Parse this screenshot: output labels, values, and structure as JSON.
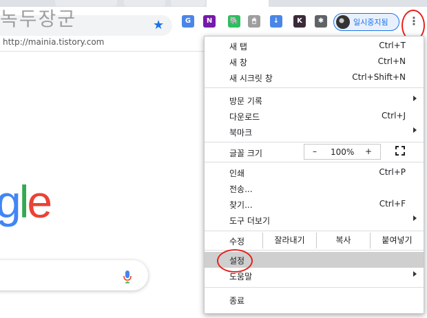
{
  "watermark": {
    "title": "녹두장군",
    "url": "http://mainia.tistory.com"
  },
  "toolbar": {
    "profile_label": "일시중지됨",
    "extensions": [
      {
        "name": "translate-extension-icon",
        "glyph": "G",
        "color": "#4a86e8"
      },
      {
        "name": "onenote-extension-icon",
        "glyph": "N",
        "color": "#7719aa"
      },
      {
        "name": "evernote-extension-icon",
        "glyph": "🐘",
        "color": "#2dbe60"
      },
      {
        "name": "mouse-extension-icon",
        "glyph": "🖱",
        "color": "#9e9e9e"
      },
      {
        "name": "file-download-extension-icon",
        "glyph": "↓",
        "color": "#4a86e8"
      },
      {
        "name": "k-extension-icon",
        "glyph": "K",
        "color": "#3c2a3a"
      },
      {
        "name": "puzzle-extension-icon",
        "glyph": "✱",
        "color": "#5f6368"
      }
    ]
  },
  "page": {
    "logo_part": [
      "g",
      "l",
      "e"
    ]
  },
  "menu": {
    "new_tab": {
      "label": "새 탭",
      "shortcut": "Ctrl+T"
    },
    "new_window": {
      "label": "새 창",
      "shortcut": "Ctrl+N"
    },
    "new_incognito": {
      "label": "새 시크릿 창",
      "shortcut": "Ctrl+Shift+N"
    },
    "history": {
      "label": "방문 기록"
    },
    "downloads": {
      "label": "다운로드",
      "shortcut": "Ctrl+J"
    },
    "bookmarks": {
      "label": "북마크"
    },
    "zoom": {
      "label": "글꼴 크기",
      "minus": "–",
      "value": "100%",
      "plus": "+"
    },
    "print": {
      "label": "인쇄",
      "shortcut": "Ctrl+P"
    },
    "cast": {
      "label": "전송..."
    },
    "find": {
      "label": "찾기...",
      "shortcut": "Ctrl+F"
    },
    "more_tools": {
      "label": "도구 더보기"
    },
    "edit": {
      "label": "수정",
      "cut": "잘라내기",
      "copy": "복사",
      "paste": "붙여넣기"
    },
    "settings": {
      "label": "설정"
    },
    "help": {
      "label": "도움말"
    },
    "exit": {
      "label": "종료"
    }
  }
}
